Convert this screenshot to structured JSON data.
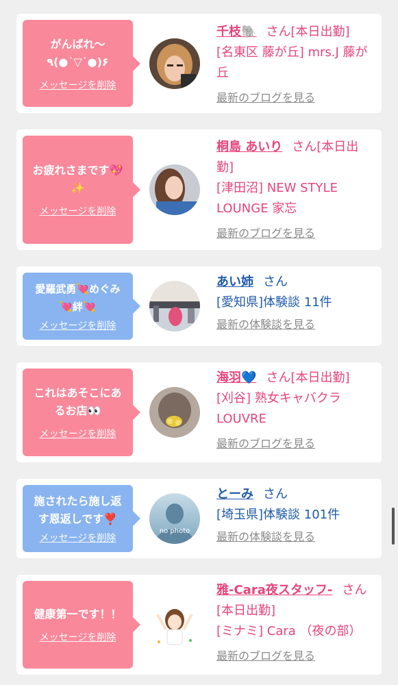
{
  "colors": {
    "pink_bubble": "#f9889a",
    "blue_bubble": "#8ab4ef",
    "pink_text": "#e6457a",
    "blue_text": "#1f5aa8"
  },
  "common": {
    "delete_label": "メッセージを削除",
    "san": "さん"
  },
  "cards": [
    {
      "message_lines": [
        "がんばれ〜",
        "٩(●˙▽˙●)۶"
      ],
      "name": "千枝🐘",
      "status": "[本日出勤]",
      "details": "[名東区 藤が丘] mrs.J 藤が丘",
      "link": "最新のブログを見る",
      "avatar": "woman-photo-1"
    },
    {
      "message_lines": [
        "お疲れさまです💖",
        "✨"
      ],
      "name": "桐島 あいり",
      "status": "[本日出勤]",
      "details": "[津田沼] NEW STYLE LOUNGE 家忘",
      "link": "最新のブログを見る",
      "avatar": "woman-photo-2"
    },
    {
      "message_lines": [
        "愛羅武勇💘めぐみ",
        "💘絆💘"
      ],
      "name": "あい姉",
      "status": "",
      "details": "[愛知県]体験談 11件",
      "link": "最新の体験談を見る",
      "avatar": "venue-photo"
    },
    {
      "message_lines": [
        "これはあそこにあ",
        "るお店👀"
      ],
      "name": "海羽💙",
      "status": "[本日出勤]",
      "details": "[刈谷] 熟女キャバクラ LOUVRE",
      "link": "最新のブログを見る",
      "avatar": "woman-photo-3"
    },
    {
      "message_lines": [
        "施されたら施し返",
        "す恩返しです❣️"
      ],
      "name": "とーみ",
      "status": "",
      "details": "[埼玉県]体験談 101件",
      "link": "最新の体験談を見る",
      "avatar": "no-photo",
      "avatar_text": "no photo"
    },
    {
      "message_lines": [
        "健康第一です！！"
      ],
      "name": "雅-Cara夜スタッフ-",
      "status": "[本日出勤]",
      "details": "[ミナミ] Cara （夜の部）",
      "link": "最新のブログを見る",
      "avatar": "cheer-illustration"
    }
  ]
}
